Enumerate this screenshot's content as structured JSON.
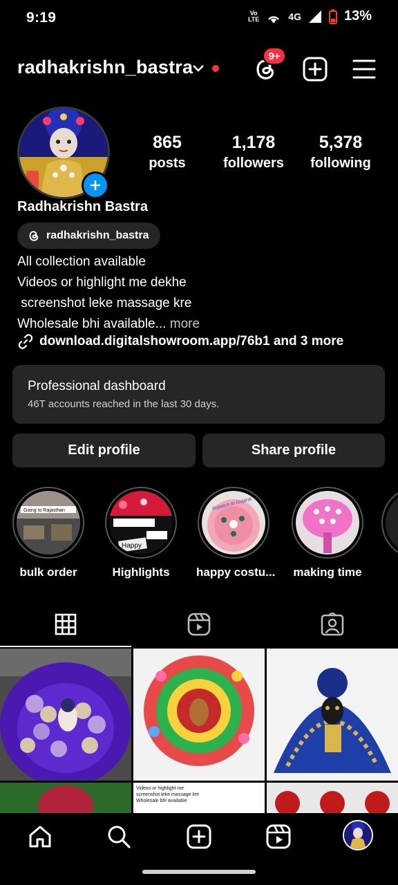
{
  "status_bar": {
    "time": "9:19",
    "volte_top": "Vo",
    "volte_bottom": "LTE",
    "network": "4G",
    "battery": "13%"
  },
  "header": {
    "username": "radhakrishn_bastra",
    "notification_badge": "9+"
  },
  "profile": {
    "name": "Radhakrishn Bastra",
    "threads_handle": "radhakrishn_bastra",
    "stats": [
      {
        "value": "865",
        "label": "posts"
      },
      {
        "value": "1,178",
        "label": "followers"
      },
      {
        "value": "5,378",
        "label": "following"
      }
    ],
    "bio_lines": [
      "All collection available",
      "Videos or highlight me dekhe",
      " screenshot leke massage kre",
      "Wholesale bhi available..."
    ],
    "bio_more": " more",
    "link_text": "download.digitalshowroom.app/76b1 and 3 more"
  },
  "dashboard": {
    "title": "Professional dashboard",
    "subtitle": "46T accounts reached in the last 30 days."
  },
  "buttons": {
    "edit": "Edit profile",
    "share": "Share profile"
  },
  "highlights": [
    {
      "label": "bulk order",
      "overlay": "Going to Rajasthan"
    },
    {
      "label": "Highlights",
      "overlay": "Happy"
    },
    {
      "label": "happy costu...",
      "overlay": "dispatch to Gujarat"
    },
    {
      "label": "making time",
      "overlay": ""
    }
  ],
  "grid": {
    "post5_text": "Videos or highlight me\nscreenshot leke massage kre\nWholesale bhi available"
  },
  "colors": {
    "background": "#000000",
    "surface": "#262626",
    "accent_blue": "#0095f6",
    "alert_red": "#ff3040"
  }
}
